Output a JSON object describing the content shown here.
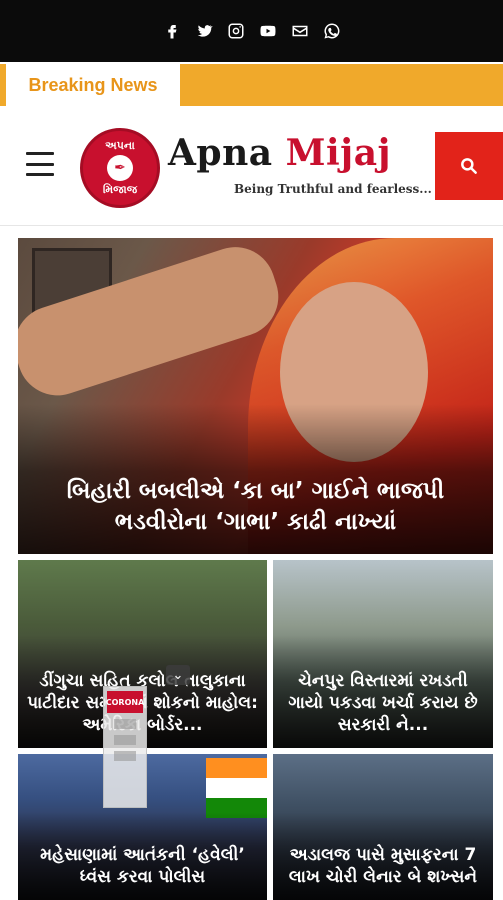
{
  "social_icons": [
    "facebook-icon",
    "twitter-icon",
    "instagram-icon",
    "youtube-icon",
    "email-icon",
    "whatsapp-icon"
  ],
  "breaking": {
    "label": "Breaking News"
  },
  "brand": {
    "name_part1": "Apna",
    "name_part2": "Mijaj",
    "tagline": "Being Truthful and fearless...",
    "logo_top": "અપના",
    "logo_bottom": "મિજાજ"
  },
  "feature": {
    "title": "બિહારી બબલીએ ‘કા બા’ ગાઈને ભાજપી ભડવીરોના ‘ગાભા’ કાઢી નાખ્યાં"
  },
  "cards": [
    {
      "title": "ડીંગુચા સહિત કલોલ તાલુકાના પાટીદાર સમાજમાં શોકનો માહોલ: અમેરિકા બોર્ડર..."
    },
    {
      "title": "ચેનપુર વિસ્તારમાં રખડતી ગાયો પકડવા ખર્ચા કરાય છે સરકારી ને..."
    },
    {
      "title": "મહેસાણામાં આતંકની ‘હવેલી’ ધ્વંસ કરવા પોલીસ"
    },
    {
      "title": "અડાલજ પાસે મુસાફરના 7 લાખ ચોરી લેનાર બે શખ્સને"
    }
  ],
  "overlay": {
    "badge": "CORONA"
  },
  "colors": {
    "accent": "#e2231a",
    "breaking_bar": "#f0a92b",
    "brand_red": "#c8102e",
    "topbar": "#0b0b0b"
  }
}
